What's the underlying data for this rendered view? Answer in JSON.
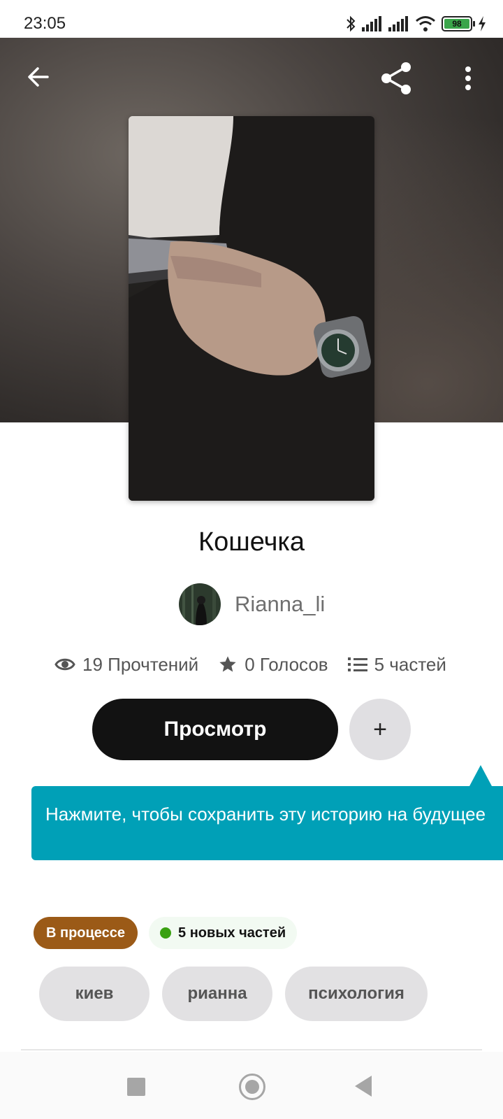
{
  "status_bar": {
    "time": "23:05",
    "battery": "98"
  },
  "header": {
    "back_icon": "arrow-left-icon",
    "share_icon": "share-icon",
    "more_icon": "more-vertical-icon"
  },
  "cover": {
    "watermark": "Rianna_li"
  },
  "story": {
    "title": "Кошечка",
    "author": "Rianna_li",
    "stats": {
      "reads": "19 Прочтений",
      "votes": "0 Голосов",
      "parts": "5 частей"
    }
  },
  "actions": {
    "read_label": "Просмотр",
    "add_label": "+"
  },
  "tooltip": {
    "text": "Нажмите, чтобы сохранить эту историю на будущее"
  },
  "badges": {
    "status": "В процессе",
    "new_parts": "5 новых частей"
  },
  "tags": [
    "киев",
    "рианна",
    "психология"
  ],
  "colors": {
    "tooltip": "#00a0b7",
    "status_badge": "#9b5a17",
    "new_dot": "#3aa112"
  }
}
